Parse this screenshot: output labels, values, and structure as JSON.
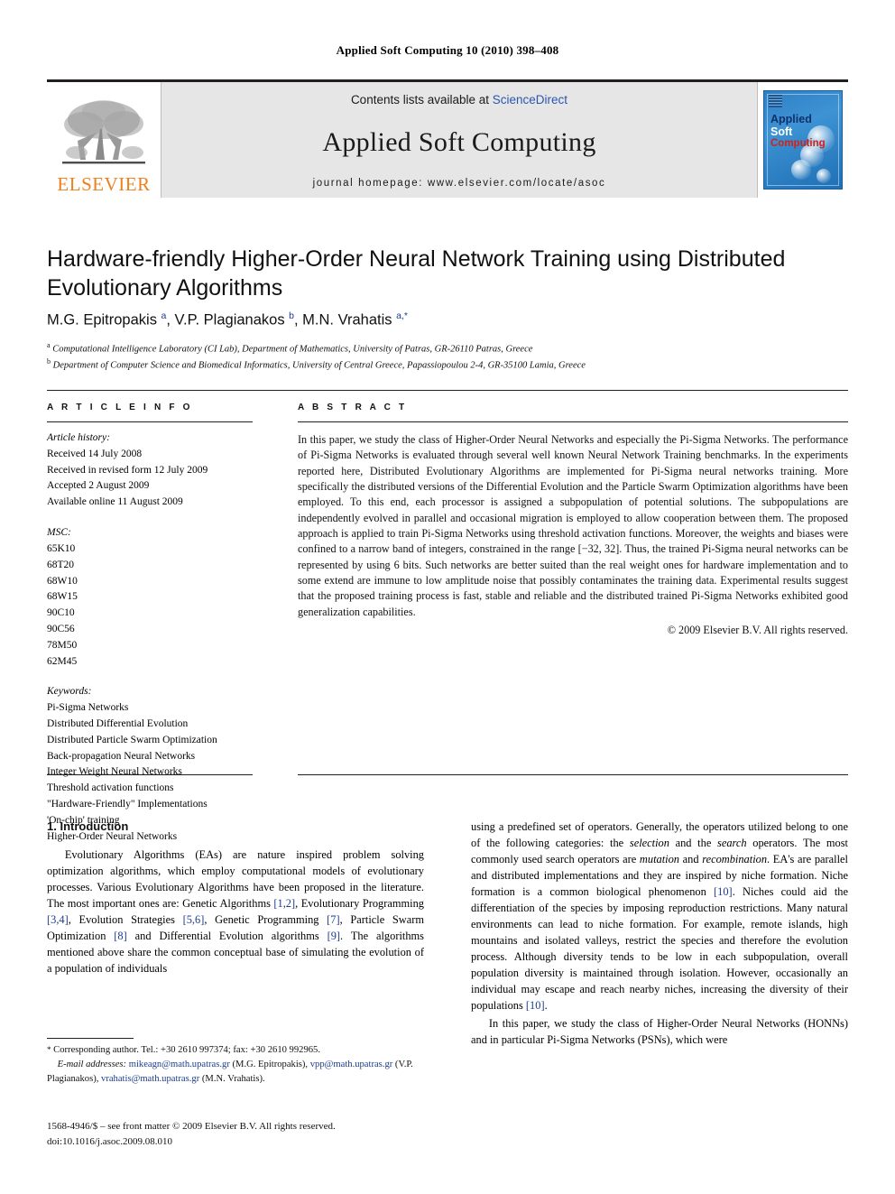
{
  "running_head": "Applied Soft Computing 10 (2010) 398–408",
  "masthead": {
    "contents_prefix": "Contents lists available at ",
    "sciencedirect": "ScienceDirect",
    "journal_title": "Applied Soft Computing",
    "homepage": "journal homepage: www.elsevier.com/locate/asoc",
    "publisher_logo_text": "ELSEVIER",
    "cover": {
      "line1": "Applied",
      "line2": "Soft",
      "line3": "Computing"
    },
    "colors": {
      "elsevier_orange": "#ef7f1a",
      "link_blue": "#2b56b0",
      "cover_blue": "#2f7fc4",
      "cover_red": "#d3201a",
      "cover_navy": "#10306b"
    }
  },
  "article": {
    "title": "Hardware-friendly Higher-Order Neural Network Training using Distributed Evolutionary Algorithms",
    "authors_html": "M.G. Epitropakis <sup>a</sup>, V.P. Plagianakos <sup>b</sup>, M.N. Vrahatis <sup>a,*</sup>",
    "affiliations": [
      "Computational Intelligence Laboratory (CI Lab), Department of Mathematics, University of Patras, GR-26110 Patras, Greece",
      "Department of Computer Science and Biomedical Informatics, University of Central Greece, Papassiopoulou 2-4, GR-35100 Lamia, Greece"
    ],
    "affiliation_marks": [
      "a",
      "b"
    ]
  },
  "article_info": {
    "heading": "A R T I C L E   I N F O",
    "history_label": "Article history:",
    "history": [
      "Received 14 July 2008",
      "Received in revised form 12 July 2009",
      "Accepted 2 August 2009",
      "Available online 11 August 2009"
    ],
    "msc_label": "MSC:",
    "msc": [
      "65K10",
      "68T20",
      "68W10",
      "68W15",
      "90C10",
      "90C56",
      "78M50",
      "62M45"
    ],
    "keywords_label": "Keywords:",
    "keywords": [
      "Pi-Sigma Networks",
      "Distributed Differential Evolution",
      "Distributed Particle Swarm Optimization",
      "Back-propagation Neural Networks",
      "Integer Weight Neural Networks",
      "Threshold activation functions",
      "\"Hardware-Friendly\" Implementations",
      "'On-chip' training",
      "Higher-Order Neural Networks"
    ]
  },
  "abstract": {
    "heading": "A B S T R A C T",
    "text": "In this paper, we study the class of Higher-Order Neural Networks and especially the Pi-Sigma Networks. The performance of Pi-Sigma Networks is evaluated through several well known Neural Network Training benchmarks. In the experiments reported here, Distributed Evolutionary Algorithms are implemented for Pi-Sigma neural networks training. More specifically the distributed versions of the Differential Evolution and the Particle Swarm Optimization algorithms have been employed. To this end, each processor is assigned a subpopulation of potential solutions. The subpopulations are independently evolved in parallel and occasional migration is employed to allow cooperation between them. The proposed approach is applied to train Pi-Sigma Networks using threshold activation functions. Moreover, the weights and biases were confined to a narrow band of integers, constrained in the range [−32, 32]. Thus, the trained Pi-Sigma neural networks can be represented by using 6 bits. Such networks are better suited than the real weight ones for hardware implementation and to some extend are immune to low amplitude noise that possibly contaminates the training data. Experimental results suggest that the proposed training process is fast, stable and reliable and the distributed trained Pi-Sigma Networks exhibited good generalization capabilities.",
    "copyright": "© 2009 Elsevier B.V. All rights reserved."
  },
  "body": {
    "section_heading": "1. Introduction",
    "left_paragraph_1_part1": "Evolutionary Algorithms (EAs) are nature inspired problem solving optimization algorithms, which employ computational models of evolutionary processes. Various Evolutionary Algorithms have been proposed in the literature. The most important ones are: Genetic Algorithms ",
    "cite_1_2": "[1,2]",
    "left_p1_seg2": ", Evolutionary Programming ",
    "cite_3_4": "[3,4]",
    "left_p1_seg3": ", Evolution Strategies ",
    "cite_5_6": "[5,6]",
    "left_p1_seg4": ", Genetic Programming ",
    "cite_7": "[7]",
    "left_p1_seg5": ", Particle Swarm Optimization ",
    "cite_8": "[8]",
    "left_p1_seg6": " and Differential Evolution algorithms ",
    "cite_9": "[9]",
    "left_p1_seg7": ". The algorithms mentioned above share the common conceptual base of simulating the evolution of a population of individuals",
    "right_p1_seg1": "using a predefined set of operators. Generally, the operators utilized belong to one of the following categories: the ",
    "em_selection": "selection",
    "right_p1_seg2": " and the ",
    "em_search": "search",
    "right_p1_seg3": " operators. The most commonly used search operators are ",
    "em_mutation": "mutation",
    "right_p1_seg4": " and ",
    "em_recombination": "recombination",
    "right_p1_seg5": ". EA's are parallel and distributed implementations and they are inspired by niche formation. Niche formation is a common biological phenomenon ",
    "cite_10_a": "[10]",
    "right_p1_seg6": ". Niches could aid the differentiation of the species by imposing reproduction restrictions. Many natural environments can lead to niche formation. For example, remote islands, high mountains and isolated valleys, restrict the species and therefore the evolution process. Although diversity tends to be low in each subpopulation, overall population diversity is maintained through isolation. However, occasionally an individual may escape and reach nearby niches, increasing the diversity of their populations ",
    "cite_10_b": "[10]",
    "right_p1_seg7": ".",
    "right_paragraph_2": "In this paper, we study the class of Higher-Order Neural Networks (HONNs) and in particular Pi-Sigma Networks (PSNs), which were"
  },
  "footnotes": {
    "corresponding_marker": "*",
    "corresponding": " Corresponding author. Tel.: +30 2610 997374; fax: +30 2610 992965.",
    "email_label": "E-mail addresses:",
    "emails": [
      {
        "address": "mikeagn@math.upatras.gr",
        "owner": " (M.G. Epitropakis),"
      },
      {
        "address": "vpp@math.upatras.gr",
        "owner": " (V.P. Plagianakos),"
      },
      {
        "address": "vrahatis@math.upatras.gr",
        "owner": " (M.N. Vrahatis)."
      }
    ],
    "imprint": "1568-4946/$ – see front matter © 2009 Elsevier B.V. All rights reserved.",
    "doi": "doi:10.1016/j.asoc.2009.08.010"
  }
}
